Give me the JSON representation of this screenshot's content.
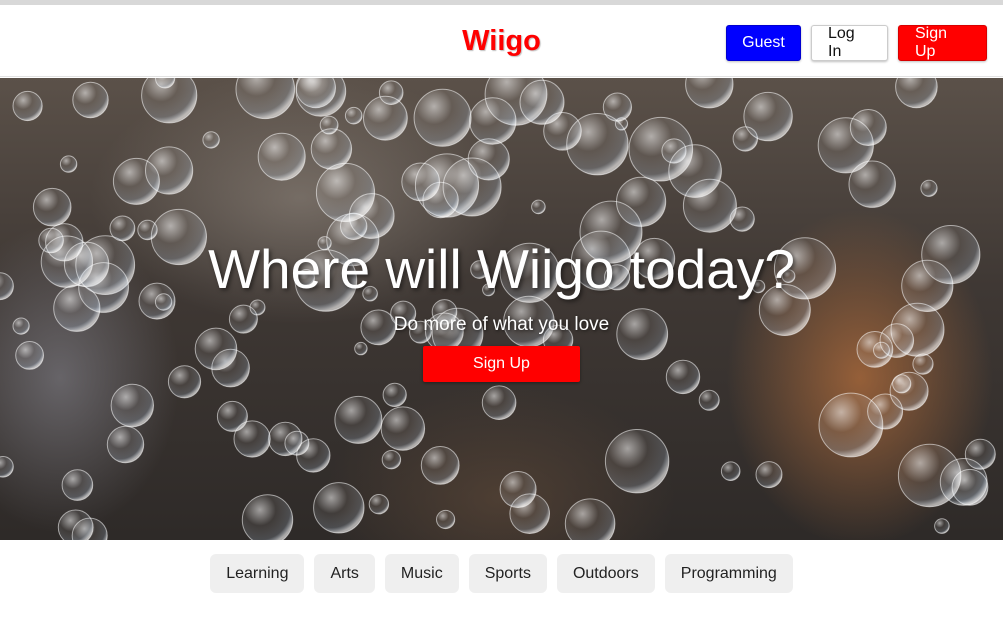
{
  "header": {
    "logo": "Wiigo",
    "guest_label": "Guest",
    "login_label": "Log In",
    "signup_label": "Sign Up"
  },
  "hero": {
    "title": "Where will Wiigo today?",
    "subtitle": "Do more of what you love",
    "cta_label": "Sign Up"
  },
  "categories": [
    "Learning",
    "Arts",
    "Music",
    "Sports",
    "Outdoors",
    "Programming"
  ],
  "colors": {
    "brand_red": "#ff0000",
    "guest_blue": "#0000ff",
    "chip_bg": "#efefef"
  }
}
